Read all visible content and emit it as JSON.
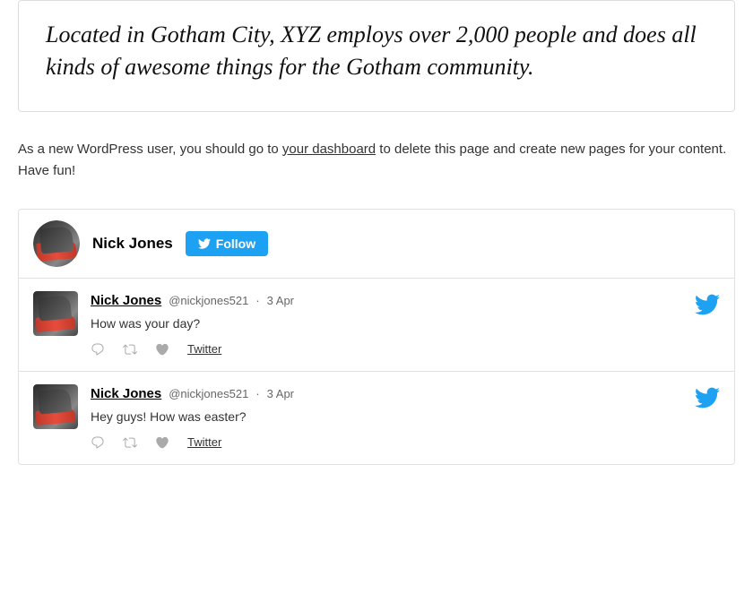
{
  "quote": {
    "text": "Located in Gotham City, XYZ employs over 2,000 people and does all kinds of awesome things for the Gotham community."
  },
  "wp_notice": {
    "text_before_link": "As a new WordPress user, you should go to ",
    "link_text": "your dashboard",
    "text_after_link": " to delete this page and create new pages for your content. Have fun!"
  },
  "twitter_widget": {
    "header": {
      "name": "Nick Jones",
      "follow_label": "Follow"
    },
    "tweets": [
      {
        "id": 1,
        "name": "Nick Jones",
        "handle": "@nickjones521",
        "date": "3 Apr",
        "text": "How was your day?",
        "link_label": "Twitter"
      },
      {
        "id": 2,
        "name": "Nick Jones",
        "handle": "@nickjones521",
        "date": "3 Apr",
        "text": "Hey guys! How was easter?",
        "link_label": "Twitter"
      }
    ]
  }
}
